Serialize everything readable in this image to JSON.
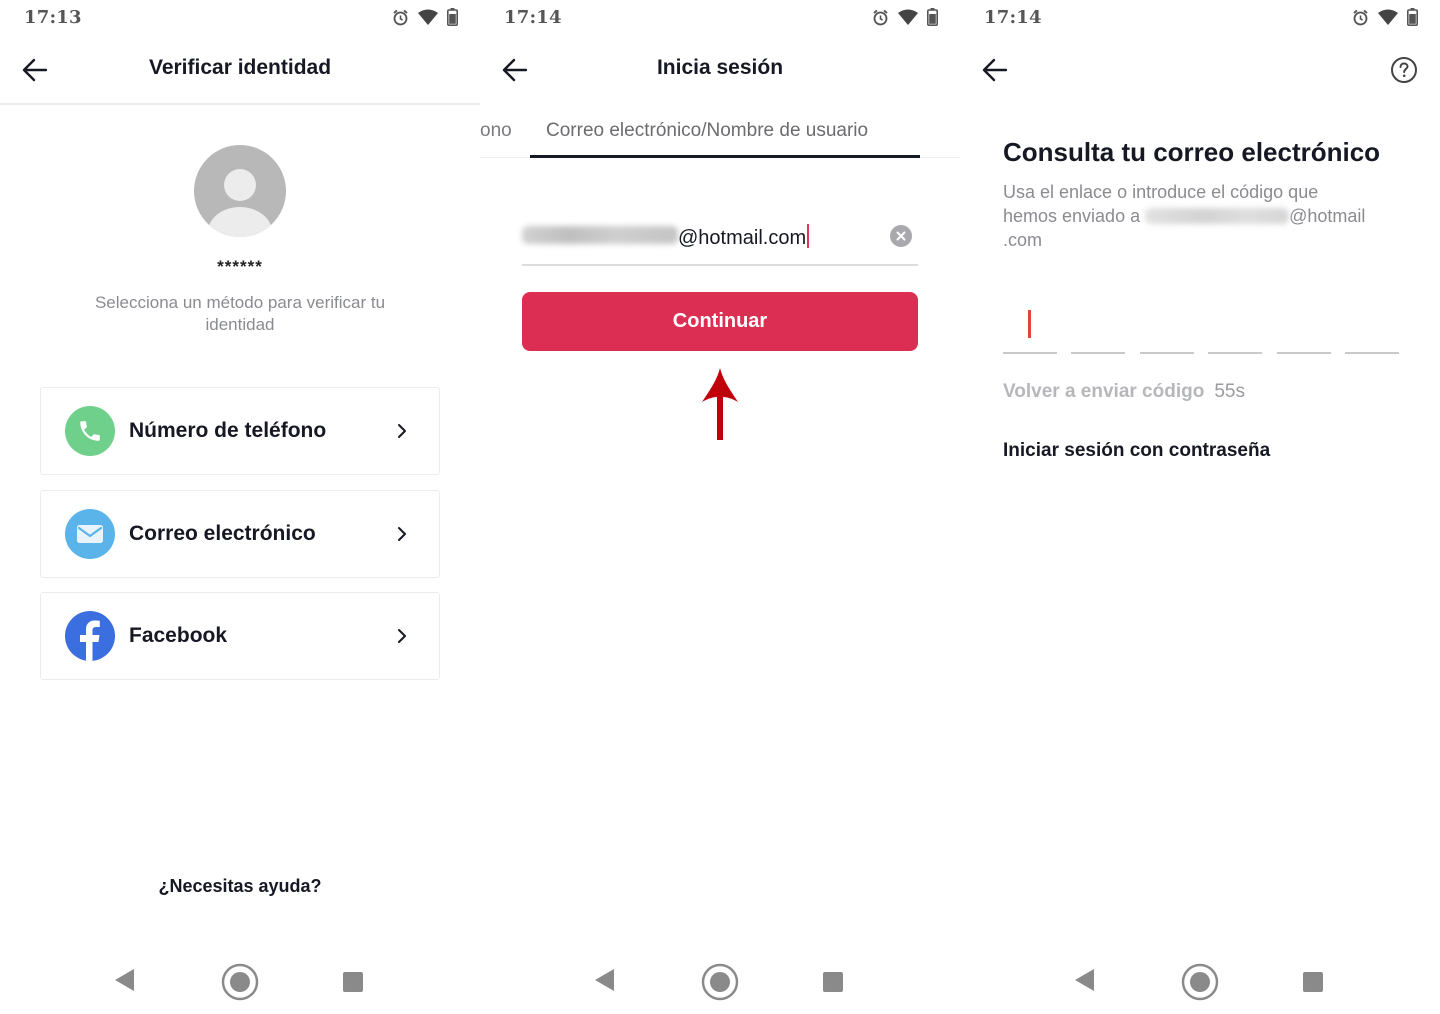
{
  "panels": [
    {
      "status": {
        "time": "17:13",
        "icons": [
          "alarm-icon",
          "wifi-icon",
          "battery-icon"
        ]
      },
      "header": {
        "title": "Verificar identidad",
        "back_icon": "arrow-left-icon"
      },
      "profile": {
        "masked_username": "******",
        "avatar_icon": "default-avatar-icon"
      },
      "subtitle": "Selecciona un método para verificar tu identidad",
      "methods": [
        {
          "label": "Número de teléfono",
          "icon": "phone-icon",
          "color": "#6fd08b"
        },
        {
          "label": "Correo electrónico",
          "icon": "mail-icon",
          "color": "#5ab4ea"
        },
        {
          "label": "Facebook",
          "icon": "facebook-icon",
          "color": "#3b6fe0"
        }
      ],
      "help_link": "¿Necesitas ayuda?",
      "navbar": [
        "nav-back-icon",
        "nav-home-icon",
        "nav-recents-icon"
      ]
    },
    {
      "status": {
        "time": "17:14",
        "icons": [
          "alarm-icon",
          "wifi-icon",
          "battery-icon"
        ]
      },
      "header": {
        "title": "Inicia sesión",
        "back_icon": "arrow-left-icon"
      },
      "tabs": [
        {
          "label": "ono",
          "active": false
        },
        {
          "label": "Correo electrónico/Nombre de usuario",
          "active": true
        }
      ],
      "email_input": {
        "value_visible": "@hotmail.com",
        "value_redacted": true
      },
      "continue_button": "Continuar",
      "accent_color": "#dc2e53",
      "annotation": {
        "type": "arrow-up",
        "color": "#c0000b"
      },
      "navbar": [
        "nav-back-icon",
        "nav-home-icon",
        "nav-recents-icon"
      ]
    },
    {
      "status": {
        "time": "17:14",
        "icons": [
          "alarm-icon",
          "wifi-icon",
          "battery-icon"
        ]
      },
      "header": {
        "back_icon": "arrow-left-icon",
        "help_icon": "question-circle-icon"
      },
      "title": "Consulta tu correo electrónico",
      "description": {
        "line1": "Usa el enlace o introduce el código que",
        "line2_prefix": "hemos enviado a ",
        "line2_suffix": "@hotmail",
        "line3": ".com"
      },
      "code_length": 6,
      "resend": {
        "label": "Volver a enviar código",
        "countdown": "55s"
      },
      "password_login": "Iniciar sesión con contraseña",
      "navbar": [
        "nav-back-icon",
        "nav-home-icon",
        "nav-recents-icon"
      ]
    }
  ]
}
